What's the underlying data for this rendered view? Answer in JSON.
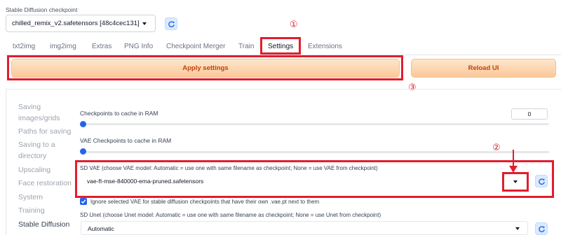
{
  "checkpoint": {
    "label": "Stable Diffusion checkpoint",
    "value": "chilled_remix_v2.safetensors [48c4cec131]",
    "refresh_icon": "refresh-icon"
  },
  "tabs": [
    "txt2img",
    "img2img",
    "Extras",
    "PNG Info",
    "Checkpoint Merger",
    "Train",
    "Settings",
    "Extensions"
  ],
  "active_tab": "Settings",
  "actions": {
    "apply": "Apply settings",
    "reload": "Reload UI"
  },
  "markers": {
    "one": "①",
    "two": "②",
    "three": "③"
  },
  "sidebar": {
    "items": [
      "Saving",
      "images/grids",
      "Paths for saving",
      "Saving to a",
      "directory",
      "Upscaling",
      "Face restoration",
      "System",
      "Training",
      "Stable Diffusion"
    ]
  },
  "settings": {
    "ckpt_cache_label": "Checkpoints to cache in RAM",
    "ckpt_cache_value": "0",
    "vae_cache_label": "VAE Checkpoints to cache in RAM",
    "sd_vae_label": "SD VAE (choose VAE model: Automatic = use one with same filename as checkpoint; None = use VAE from checkpoint)",
    "sd_vae_value": "vae-ft-mse-840000-ema-pruned.safetensors",
    "ignore_vae_label": "Ignore selected VAE for stable diffusion checkpoints that have their own .vae.pt next to them",
    "sd_unet_label": "SD Unet (choose Unet model: Automatic = use one with same filename as checkpoint; None = use Unet from checkpoint)",
    "sd_unet_value": "Automatic"
  },
  "colors": {
    "accent": "#2563eb",
    "highlight": "#e11d2e",
    "button_text": "#c2410c"
  }
}
